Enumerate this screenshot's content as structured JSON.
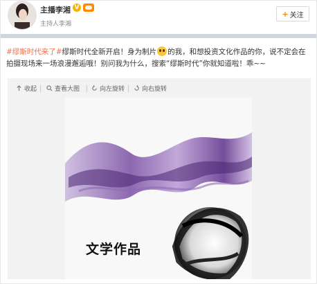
{
  "header": {
    "user_name": "主播李湘",
    "verified_badge": "V",
    "subtitle": "主持人李湘",
    "follow_label": "关注",
    "follow_plus": "+"
  },
  "post": {
    "tag1": "#缪斯时代来了#",
    "text1": "缪斯时代全新开启！身为制片",
    "text2": "的我，和想投资文化作品的你，说不定会在拍摄现场来一场浪漫邂逅哦！别问我为什么，搜索“缪斯时代”你就知道啦！乖~~"
  },
  "toolbar": {
    "collapse": "收起",
    "view_large": "查看大图",
    "rotate_left": "向左旋转",
    "rotate_right": "向右旋转"
  },
  "image": {
    "title": "文学作品"
  },
  "icons": {
    "collapse": "collapse-arrow-icon",
    "view_large": "magnifier-icon",
    "rotate_left": "rotate-left-icon",
    "rotate_right": "rotate-right-icon",
    "emoji": "emoji-face-icon"
  },
  "colors": {
    "tag": "#eb7350",
    "follow_plus": "#f08a00",
    "vip_badge": "#ff8a00",
    "verified_badge": "#f5b400"
  }
}
